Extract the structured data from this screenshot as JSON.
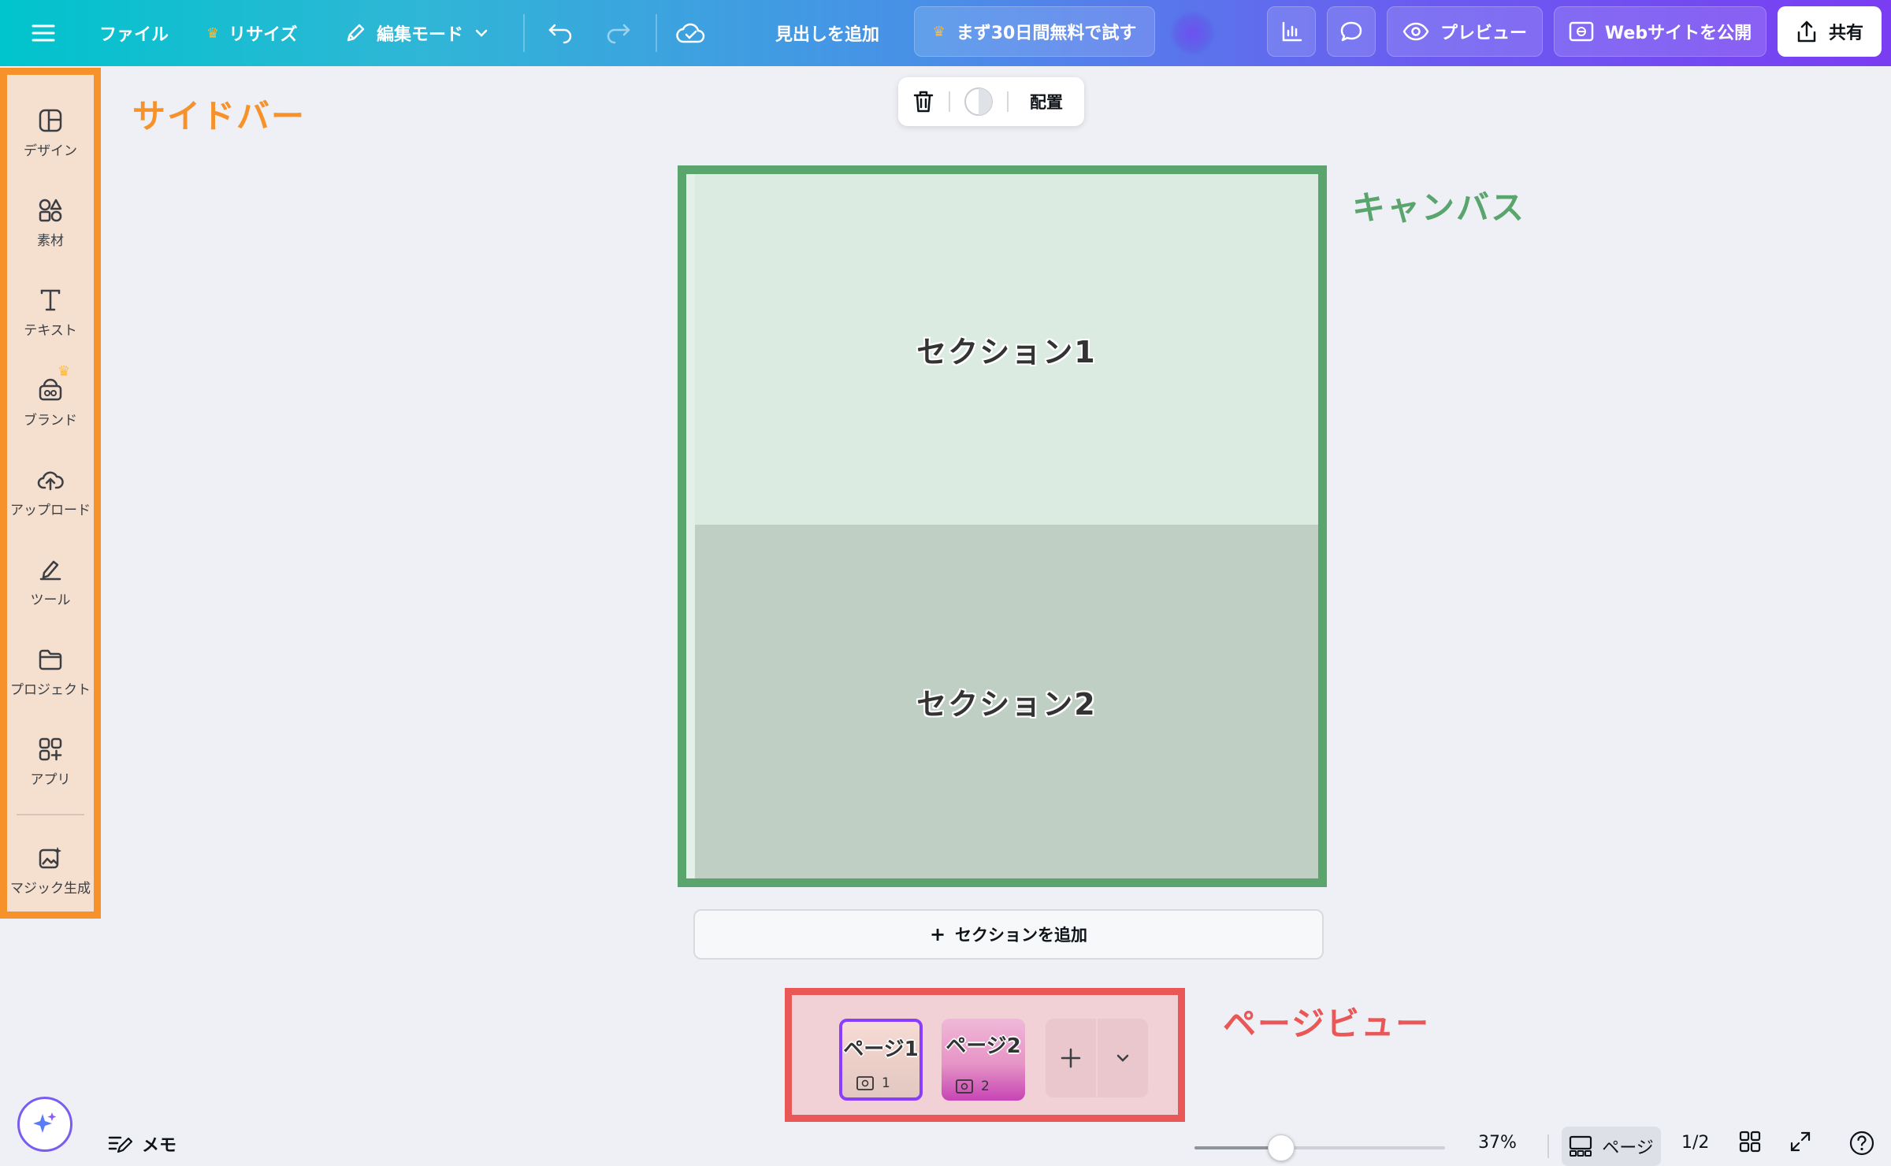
{
  "topbar": {
    "file_label": "ファイル",
    "resize_label": "リサイズ",
    "edit_mode_label": "編集モード",
    "add_heading_label": "見出しを追加",
    "trial_label": "まず30日間無料で試す",
    "preview_label": "プレビュー",
    "publish_label": "Webサイトを公開",
    "share_label": "共有"
  },
  "sidebar": {
    "items": [
      {
        "label": "デザイン",
        "icon": "design-icon"
      },
      {
        "label": "素材",
        "icon": "elements-icon"
      },
      {
        "label": "テキスト",
        "icon": "text-icon"
      },
      {
        "label": "ブランド",
        "icon": "brand-icon"
      },
      {
        "label": "アップロード",
        "icon": "upload-icon"
      },
      {
        "label": "ツール",
        "icon": "tools-icon"
      },
      {
        "label": "プロジェクト",
        "icon": "projects-icon"
      },
      {
        "label": "アプリ",
        "icon": "apps-icon"
      },
      {
        "label": "マジック生成",
        "icon": "magic-media-icon"
      }
    ]
  },
  "annotations": {
    "sidebar": "サイドバー",
    "canvas": "キャンバス",
    "pageview": "ページビュー"
  },
  "context_toolbar": {
    "arrange_label": "配置"
  },
  "canvas": {
    "sections": [
      {
        "label": "セクション1"
      },
      {
        "label": "セクション2"
      }
    ],
    "add_section_label": "セクションを追加"
  },
  "pageview": {
    "pages": [
      {
        "title": "ページ1",
        "number": "1"
      },
      {
        "title": "ページ2",
        "number": "2"
      }
    ]
  },
  "bottombar": {
    "memo_label": "メモ",
    "zoom_value": 0.37,
    "zoom_text": "37%",
    "pages_label": "ページ",
    "page_counter": "1/2"
  },
  "colors": {
    "sidebar_annotation": "#f7922b",
    "canvas_annotation": "#5aa56e",
    "pageview_annotation": "#ea5757",
    "selected_page": "#8b3dff"
  }
}
